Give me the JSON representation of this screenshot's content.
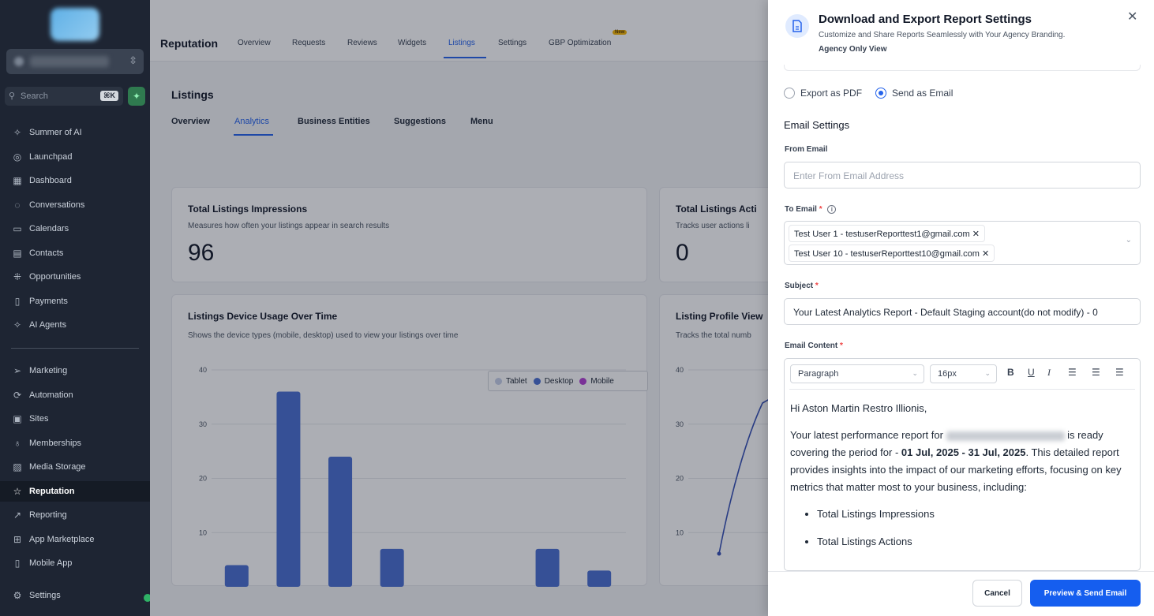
{
  "sidebar": {
    "search_placeholder": "Search",
    "search_shortcut": "⌘K",
    "items": [
      {
        "label": "Summer of AI",
        "icon": "sparkle-icon"
      },
      {
        "label": "Launchpad",
        "icon": "rocket-icon"
      },
      {
        "label": "Dashboard",
        "icon": "grid-icon"
      },
      {
        "label": "Conversations",
        "icon": "chat-icon"
      },
      {
        "label": "Calendars",
        "icon": "calendar-icon"
      },
      {
        "label": "Contacts",
        "icon": "contacts-icon"
      },
      {
        "label": "Opportunities",
        "icon": "opportunities-icon"
      },
      {
        "label": "Payments",
        "icon": "payments-icon"
      },
      {
        "label": "AI Agents",
        "icon": "sparkle-icon"
      },
      {
        "label": "Marketing",
        "icon": "send-icon"
      },
      {
        "label": "Automation",
        "icon": "automation-icon"
      },
      {
        "label": "Sites",
        "icon": "sites-icon"
      },
      {
        "label": "Memberships",
        "icon": "award-icon"
      },
      {
        "label": "Media Storage",
        "icon": "image-icon"
      },
      {
        "label": "Reputation",
        "icon": "star-icon"
      },
      {
        "label": "Reporting",
        "icon": "trend-icon"
      },
      {
        "label": "App Marketplace",
        "icon": "apps-icon"
      },
      {
        "label": "Mobile App",
        "icon": "mobile-icon"
      },
      {
        "label": "Settings",
        "icon": "gear-icon"
      }
    ],
    "active": "Reputation"
  },
  "topbar": {
    "title": "Reputation",
    "tabs": [
      "Overview",
      "Requests",
      "Reviews",
      "Widgets",
      "Listings",
      "Settings",
      "GBP Optimization"
    ],
    "active_tab": "Listings",
    "new_badge": "New"
  },
  "page": {
    "title": "Listings",
    "subtabs": [
      "Overview",
      "Analytics",
      "Business Entities",
      "Suggestions",
      "Menu"
    ],
    "active_subtab": "Analytics"
  },
  "cards": {
    "impressions": {
      "title": "Total Listings Impressions",
      "subtitle": "Measures how often your listings appear in search results",
      "value": "96"
    },
    "actions": {
      "title": "Total Listings Acti",
      "subtitle": "Tracks user actions li",
      "value": "0"
    },
    "device_usage": {
      "title": "Listings Device Usage Over Time",
      "subtitle": "Shows the device types (mobile, desktop) used to view your listings over time"
    },
    "profile_views": {
      "title": "Listing Profile View",
      "subtitle": "Tracks the total numb"
    }
  },
  "chart_data": [
    {
      "type": "bar",
      "title": "Listings Device Usage Over Time",
      "ylim": [
        0,
        40
      ],
      "yticks": [
        10,
        20,
        30,
        40
      ],
      "grid": true,
      "legend_position": "top-right",
      "legend": [
        {
          "name": "Tablet",
          "color": "#c7d0e8"
        },
        {
          "name": "Desktop",
          "color": "#4a6fd1"
        },
        {
          "name": "Mobile",
          "color": "#b23fd3"
        }
      ],
      "series": [
        {
          "name": "Desktop",
          "color": "#4a6fd1",
          "values": [
            4,
            36,
            24,
            7,
            0,
            0,
            7,
            3
          ]
        }
      ]
    },
    {
      "type": "line",
      "title": "Listing Profile View",
      "ylim": [
        0,
        40
      ],
      "yticks": [
        10,
        20,
        30,
        40
      ],
      "grid": true
    }
  ],
  "drawer": {
    "title": "Download and Export Report Settings",
    "subtitle": "Customize and Share Reports Seamlessly with Your Agency Branding.",
    "agency_note": "Agency Only View",
    "export_options": [
      {
        "label": "Export as PDF",
        "selected": false
      },
      {
        "label": "Send as Email",
        "selected": true
      }
    ],
    "email_settings_title": "Email Settings",
    "from_label": "From Email",
    "from_placeholder": "Enter From Email Address",
    "to_label": "To Email",
    "to_tags": [
      "Test User 1 - testuserReporttest1@gmail.com",
      "Test User 10 - testuserReporttest10@gmail.com"
    ],
    "subject_label": "Subject",
    "subject_value": "Your Latest Analytics Report - Default Staging account(do not modify) - 0",
    "content_label": "Email Content",
    "toolbar": {
      "paragraph": "Paragraph",
      "font_size": "16px"
    },
    "greeting": "Hi Aston Martin Restro Illionis,",
    "body_1a": "Your latest performance report for",
    "body_1b": "is ready covering the period for -",
    "period": "01 Jul, 2025 - 31 Jul, 2025",
    "body_1c": ". This detailed report provides insights into the impact of our marketing efforts, focusing on key metrics that matter most to your business, including:",
    "bullets": [
      "Total Listings Impressions",
      "Total Listings Actions"
    ],
    "cancel": "Cancel",
    "primary": "Preview & Send Email"
  },
  "colors": {
    "accent": "#155eef",
    "sidebar_bg": "#1e2533",
    "bar": "#4a6fd1"
  }
}
